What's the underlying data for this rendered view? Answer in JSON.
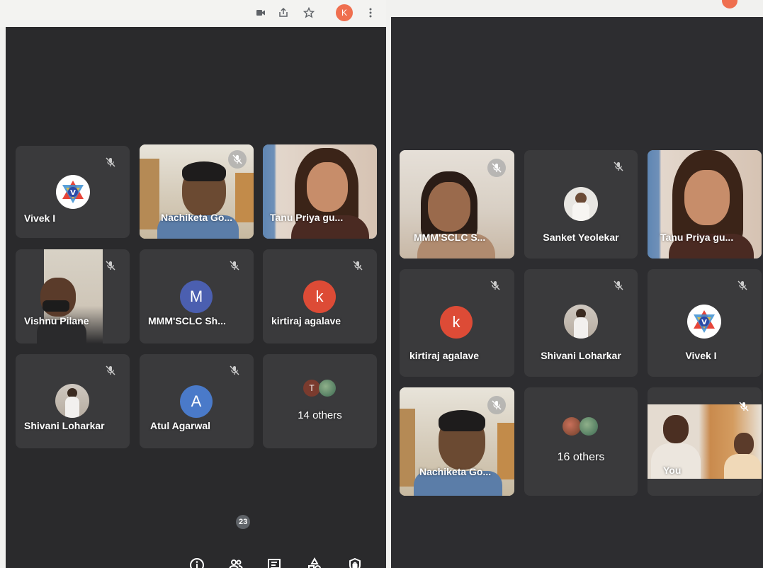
{
  "browser": {
    "profile_initial": "K",
    "icons": [
      "camera-icon",
      "share-icon",
      "star-icon",
      "more-icon"
    ]
  },
  "left_meeting": {
    "tiles": [
      {
        "name": "Vivek I",
        "type": "logo"
      },
      {
        "name": "Nachiketa Go...",
        "type": "video"
      },
      {
        "name": "Tanu Priya gu...",
        "type": "video"
      },
      {
        "name": "Vishnu Pilane",
        "type": "video"
      },
      {
        "name": "MMM'SCLC Sh...",
        "type": "avatar",
        "initial": "M"
      },
      {
        "name": "kirtiraj agalave",
        "type": "avatar",
        "initial": "k"
      },
      {
        "name": "Shivani Loharkar",
        "type": "photo"
      },
      {
        "name": "Atul Agarwal",
        "type": "avatar",
        "initial": "A"
      },
      {
        "name": "14 others",
        "type": "others",
        "initial": "T"
      }
    ],
    "toolbar": {
      "participants_count": "23",
      "icons": [
        "info-icon",
        "people-icon",
        "chat-icon",
        "activities-icon",
        "host-controls-icon"
      ]
    }
  },
  "right_meeting": {
    "tiles": [
      {
        "name": "MMM'SCLC S...",
        "type": "video"
      },
      {
        "name": "Sanket Yeolekar",
        "type": "photo"
      },
      {
        "name": "Tanu Priya gu...",
        "type": "video"
      },
      {
        "name": "kirtiraj agalave",
        "type": "avatar",
        "initial": "k"
      },
      {
        "name": "Shivani Loharkar",
        "type": "photo"
      },
      {
        "name": "Vivek I",
        "type": "logo"
      },
      {
        "name": "Nachiketa Go...",
        "type": "video"
      },
      {
        "name": "16 others",
        "type": "others"
      },
      {
        "name": "You",
        "type": "video"
      }
    ]
  },
  "colors": {
    "background": "#2b2b2d",
    "tile": "#3a3a3c",
    "avatar_blue": "#4b5fb0",
    "avatar_red": "#dd4b36",
    "avatar_azure": "#4a7ac9"
  }
}
